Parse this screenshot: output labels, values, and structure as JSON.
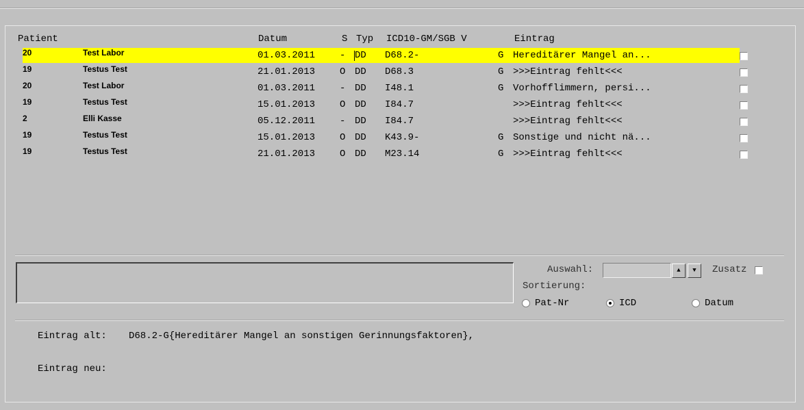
{
  "columns": {
    "patient": "Patient",
    "datum": "Datum",
    "s": "S",
    "typ": "Typ",
    "icd": "ICD10-GM/SGB V",
    "eintrag": "Eintrag"
  },
  "rows": [
    {
      "nr": "20",
      "name": "Test Labor",
      "datum": "01.03.2011",
      "s": "-",
      "typ": "DD",
      "icd": "D68.2-",
      "g": "G",
      "eintrag": "Hereditärer Mangel an...",
      "selected": true
    },
    {
      "nr": "19",
      "name": "Testus Test",
      "datum": "21.01.2013",
      "s": "O",
      "typ": "DD",
      "icd": "D68.3",
      "g": "G",
      "eintrag": ">>>Eintrag fehlt<<<"
    },
    {
      "nr": "20",
      "name": "Test Labor",
      "datum": "01.03.2011",
      "s": "-",
      "typ": "DD",
      "icd": "I48.1",
      "g": "G",
      "eintrag": "Vorhofflimmern, persi..."
    },
    {
      "nr": "19",
      "name": "Testus Test",
      "datum": "15.01.2013",
      "s": "O",
      "typ": "DD",
      "icd": "I84.7",
      "g": "",
      "eintrag": ">>>Eintrag fehlt<<<"
    },
    {
      "nr": "2",
      "name": "Elli Kasse",
      "datum": "05.12.2011",
      "s": "-",
      "typ": "DD",
      "icd": "I84.7",
      "g": "",
      "eintrag": ">>>Eintrag fehlt<<<"
    },
    {
      "nr": "19",
      "name": "Testus Test",
      "datum": "15.01.2013",
      "s": "O",
      "typ": "DD",
      "icd": "K43.9-",
      "g": "G",
      "eintrag": "Sonstige und nicht nä..."
    },
    {
      "nr": "19",
      "name": "Testus Test",
      "datum": "21.01.2013",
      "s": "O",
      "typ": "DD",
      "icd": "M23.14",
      "g": "G",
      "eintrag": ">>>Eintrag fehlt<<<"
    }
  ],
  "controls": {
    "auswahl_label": "Auswahl:",
    "auswahl_value": "",
    "zusatz_label": "Zusatz",
    "sortierung_label": "Sortierung:",
    "sort_options": [
      "Pat-Nr",
      "ICD",
      "Datum"
    ],
    "sort_selected": "ICD",
    "spin_up": "▲",
    "spin_down": "▼"
  },
  "footer": {
    "alt_label": "Eintrag alt:",
    "alt_value": "D68.2-G{Hereditärer Mangel an sonstigen Gerinnungsfaktoren},",
    "neu_label": "Eintrag neu:",
    "neu_value": ""
  },
  "colors": {
    "background": "#c0c0c0",
    "selection": "#ffff00"
  }
}
